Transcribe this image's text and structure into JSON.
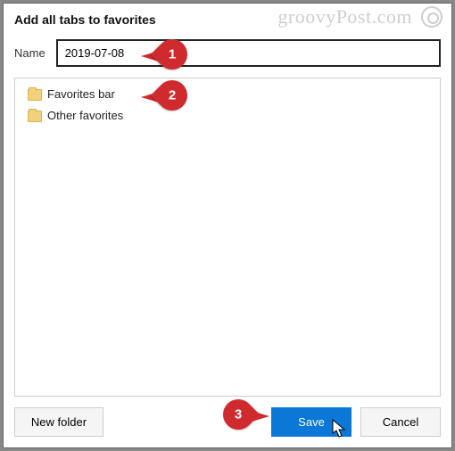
{
  "dialog": {
    "title": "Add all tabs to favorites",
    "name_label": "Name",
    "name_value": "2019-07-08"
  },
  "tree": {
    "items": [
      {
        "label": "Favorites bar"
      },
      {
        "label": "Other favorites"
      }
    ]
  },
  "buttons": {
    "new_folder": "New folder",
    "save": "Save",
    "cancel": "Cancel"
  },
  "annotations": {
    "c1": "1",
    "c2": "2",
    "c3": "3"
  },
  "watermark": "groovyPost.com"
}
